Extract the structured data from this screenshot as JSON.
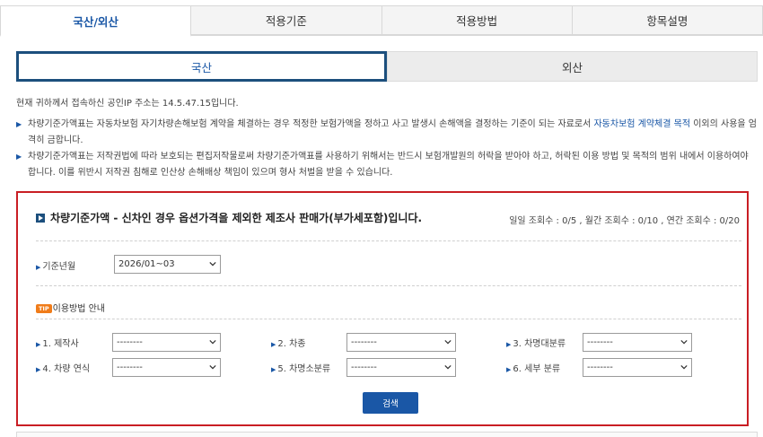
{
  "tabs": [
    {
      "label": "국산/외산"
    },
    {
      "label": "적용기준"
    },
    {
      "label": "적용방법"
    },
    {
      "label": "항목설명"
    }
  ],
  "subtabs": [
    {
      "label": "국산"
    },
    {
      "label": "외산"
    }
  ],
  "ip_notice": "현재 귀하께서 접속하신 공인IP 주소는 14.5.47.15입니다.",
  "notices": [
    {
      "pre": "차량기준가액표는 자동차보험 자기차량손해보험 계약을 체결하는 경우 적정한 보험가액을 정하고 사고 발생시 손해액을 결정하는 기준이 되는 자료로서 ",
      "highlight": "자동차보험 계약체결 목적",
      "post": " 이외의 사용을 엄격히 금합니다."
    },
    {
      "pre": "차량기준가액표는 저작권법에 따라 보호되는 편집저작물로써 차량기준가액표를 사용하기 위해서는 반드시 보험개발원의 허락을 받아야 하고, 허락된 이용 방법 및 목적의 범위 내에서 이용하여야 합니다. 이를 위반시 저작권 침해로 인산상 손해배상 책임이 있으며 형사 처벌을 받을 수 있습니다.",
      "highlight": "",
      "post": ""
    }
  ],
  "panel": {
    "title": "차량기준가액 - 신차인 경우 옵션가격을 제외한 제조사 판매가(부가세포함)입니다.",
    "views": "일일 조회수 : 0/5 , 월간 조회수 : 0/10 , 연간 조회수 : 0/20",
    "base_month": {
      "label": "기준년월",
      "value": "2026/01~03"
    },
    "tip": {
      "badge": "TIP",
      "label": "이용방법 안내"
    },
    "filters": [
      {
        "label": "1. 제작사",
        "value": "--------"
      },
      {
        "label": "2. 차종",
        "value": "--------"
      },
      {
        "label": "3. 차명대분류",
        "value": "--------"
      },
      {
        "label": "4. 차량 연식",
        "value": "--------"
      },
      {
        "label": "5. 차명소분류",
        "value": "--------"
      },
      {
        "label": "6. 세부 분류",
        "value": "--------"
      }
    ],
    "search_label": "검색"
  },
  "colors": {
    "accent": "#1a57a6",
    "border_red": "#c91e24",
    "active_border": "#1c4f7d",
    "tip": "#f07c1a"
  }
}
